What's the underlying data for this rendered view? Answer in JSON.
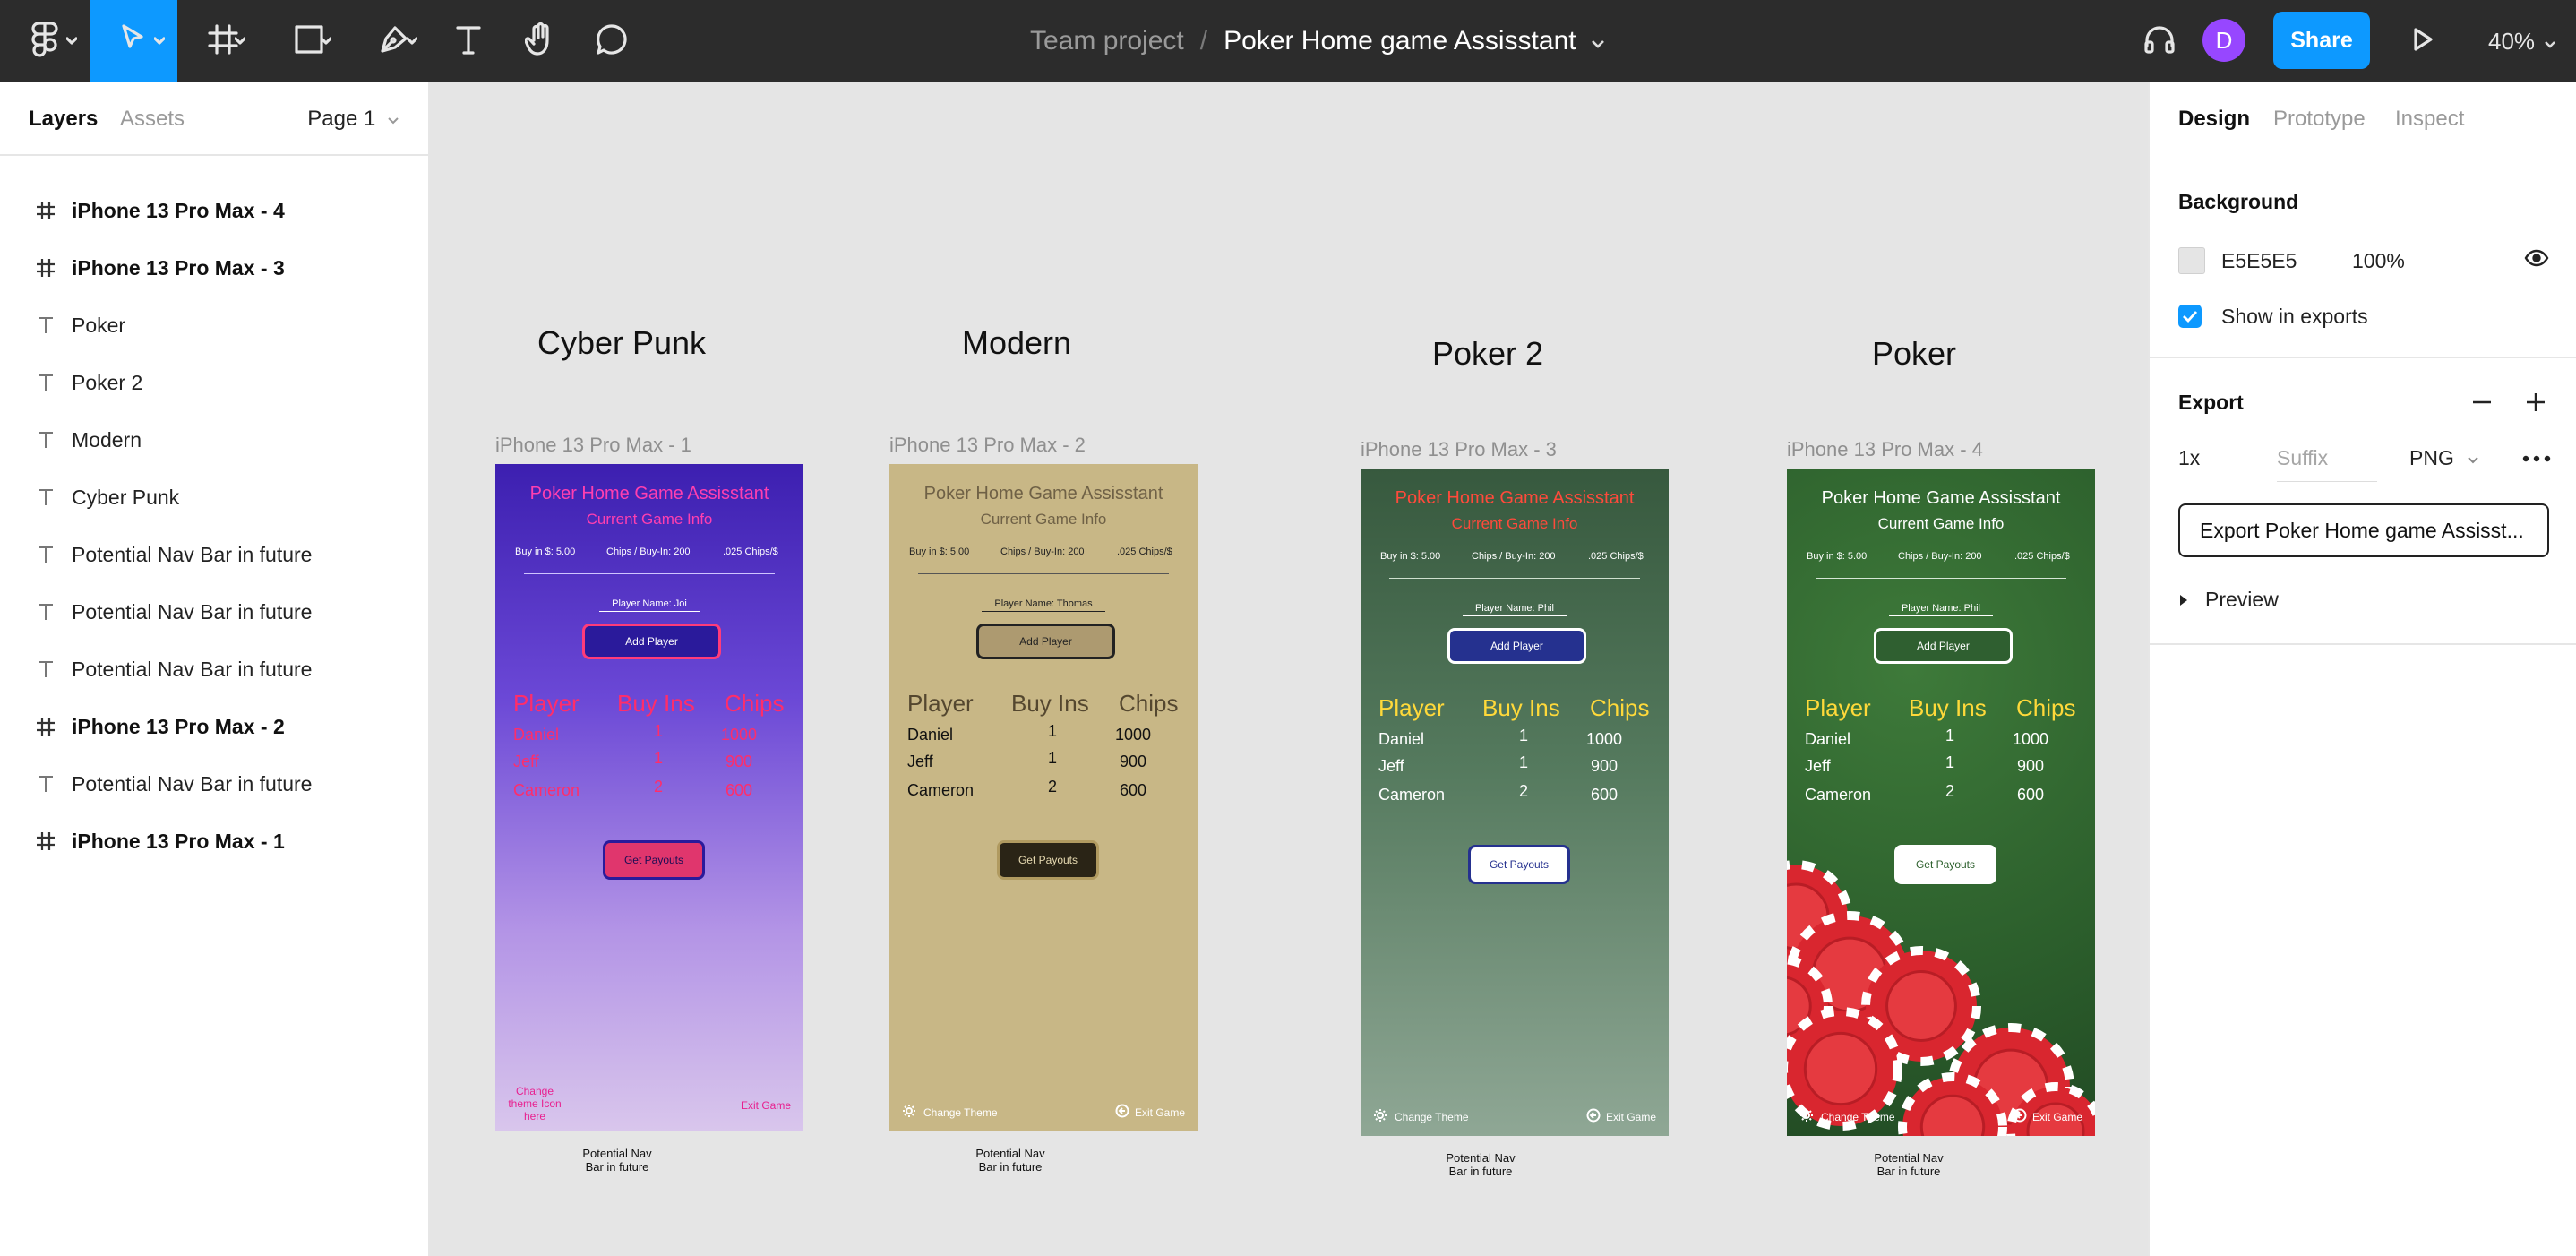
{
  "toolbar": {
    "breadcrumb_team": "Team project",
    "breadcrumb_separator": "/",
    "file_name": "Poker Home game Assisstant",
    "avatar_initial": "D",
    "share_label": "Share",
    "zoom_label": "40%"
  },
  "left_panel": {
    "tab_layers": "Layers",
    "tab_assets": "Assets",
    "page_selector": "Page 1",
    "layers": [
      {
        "type": "frame",
        "label": "iPhone 13 Pro Max - 4"
      },
      {
        "type": "frame",
        "label": "iPhone 13 Pro Max - 3"
      },
      {
        "type": "text",
        "label": "Poker"
      },
      {
        "type": "text",
        "label": "Poker 2"
      },
      {
        "type": "text",
        "label": "Modern"
      },
      {
        "type": "text",
        "label": "Cyber Punk"
      },
      {
        "type": "text",
        "label": "Potential Nav Bar in future"
      },
      {
        "type": "text",
        "label": "Potential Nav Bar in future"
      },
      {
        "type": "text",
        "label": "Potential Nav Bar in future"
      },
      {
        "type": "frame",
        "label": "iPhone 13 Pro Max - 2"
      },
      {
        "type": "text",
        "label": "Potential Nav Bar in future"
      },
      {
        "type": "frame",
        "label": "iPhone 13 Pro Max - 1"
      }
    ]
  },
  "right_panel": {
    "tab_design": "Design",
    "tab_prototype": "Prototype",
    "tab_inspect": "Inspect",
    "background_title": "Background",
    "background_hex": "E5E5E5",
    "background_opacity": "100%",
    "show_in_exports": "Show in exports",
    "export_title": "Export",
    "export_scale": "1x",
    "export_suffix_placeholder": "Suffix",
    "export_format": "PNG",
    "export_button": "Export Poker Home game Assisst...",
    "preview_label": "Preview"
  },
  "canvas": {
    "themes": [
      {
        "section_title": "Cyber Punk",
        "frame_label": "iPhone 13 Pro Max - 1",
        "app_title": "Poker Home Game Assisstant",
        "subtitle": "Current Game Info",
        "buy_in": "Buy in $: 5.00",
        "chips_per_buyin": "Chips / Buy-In: 200",
        "chips_rate": ".025 Chips/$",
        "player_name": "Player Name: Joi",
        "add_player": "Add Player",
        "headers": [
          "Player",
          "Buy Ins",
          "Chips"
        ],
        "rows": [
          [
            "Daniel",
            "1",
            "1000"
          ],
          [
            "Jeff",
            "1",
            "900"
          ],
          [
            "Cameron",
            "2",
            "600"
          ]
        ],
        "get_payouts": "Get Payouts",
        "nav_left": "Change theme Icon here",
        "nav_right": "Exit Game",
        "nav_note": "Potential Nav Bar in future"
      },
      {
        "section_title": "Modern",
        "frame_label": "iPhone 13 Pro Max - 2",
        "app_title": "Poker Home Game Assisstant",
        "subtitle": "Current Game Info",
        "buy_in": "Buy in $: 5.00",
        "chips_per_buyin": "Chips / Buy-In: 200",
        "chips_rate": ".025 Chips/$",
        "player_name": "Player Name: Thomas",
        "add_player": "Add Player",
        "headers": [
          "Player",
          "Buy Ins",
          "Chips"
        ],
        "rows": [
          [
            "Daniel",
            "1",
            "1000"
          ],
          [
            "Jeff",
            "1",
            "900"
          ],
          [
            "Cameron",
            "2",
            "600"
          ]
        ],
        "get_payouts": "Get Payouts",
        "nav_left": "Change Theme",
        "nav_right": "Exit Game",
        "nav_note": "Potential Nav Bar in future"
      },
      {
        "section_title": "Poker 2",
        "frame_label": "iPhone 13 Pro Max - 3",
        "app_title": "Poker Home Game Assisstant",
        "subtitle": "Current Game Info",
        "buy_in": "Buy in $: 5.00",
        "chips_per_buyin": "Chips / Buy-In: 200",
        "chips_rate": ".025 Chips/$",
        "player_name": "Player Name: Phil",
        "add_player": "Add Player",
        "headers": [
          "Player",
          "Buy Ins",
          "Chips"
        ],
        "rows": [
          [
            "Daniel",
            "1",
            "1000"
          ],
          [
            "Jeff",
            "1",
            "900"
          ],
          [
            "Cameron",
            "2",
            "600"
          ]
        ],
        "get_payouts": "Get Payouts",
        "nav_left": "Change Theme",
        "nav_right": "Exit Game",
        "nav_note": "Potential Nav Bar in future"
      },
      {
        "section_title": "Poker",
        "frame_label": "iPhone 13 Pro Max - 4",
        "app_title": "Poker Home Game Assisstant",
        "subtitle": "Current Game Info",
        "buy_in": "Buy in $: 5.00",
        "chips_per_buyin": "Chips / Buy-In: 200",
        "chips_rate": ".025 Chips/$",
        "player_name": "Player Name: Phil",
        "add_player": "Add Player",
        "headers": [
          "Player",
          "Buy Ins",
          "Chips"
        ],
        "rows": [
          [
            "Daniel",
            "1",
            "1000"
          ],
          [
            "Jeff",
            "1",
            "900"
          ],
          [
            "Cameron",
            "2",
            "600"
          ]
        ],
        "get_payouts": "Get Payouts",
        "nav_left": "Change Theme",
        "nav_right": "Exit Game",
        "nav_note": "Potential Nav Bar in future"
      }
    ]
  },
  "colors": {
    "toolbar_bg": "#2c2c2c",
    "accent_blue": "#0d99ff",
    "avatar_purple": "#9747ff",
    "canvas_bg": "#e5e5e5"
  }
}
